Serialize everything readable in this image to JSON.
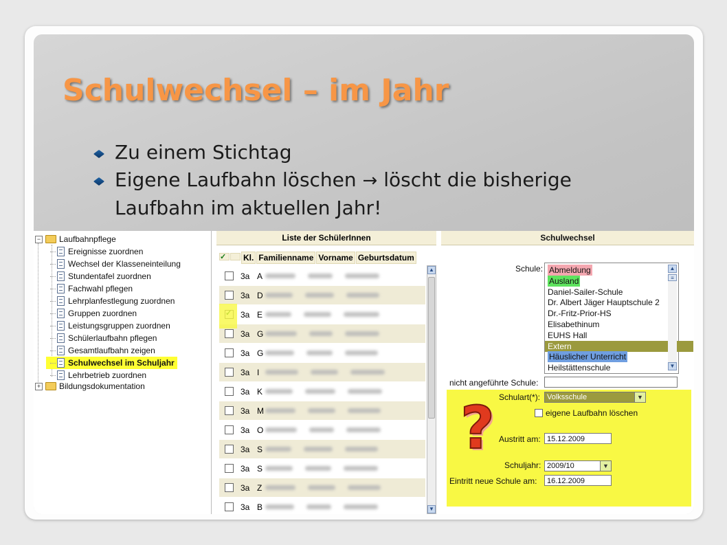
{
  "title": "Schulwechsel – im Jahr",
  "bullets": [
    {
      "text": "Zu einem Stichtag"
    },
    {
      "text_before": "Eigene Laufbahn löschen ",
      "arrow": "→",
      "text_after": " löscht die bisherige Laufbahn im aktuellen Jahr!"
    }
  ],
  "tree": {
    "root": "Laufbahnpflege",
    "items": [
      "Ereignisse zuordnen",
      "Wechsel der Klasseneinteilung",
      "Stundentafel zuordnen",
      "Fachwahl pflegen",
      "Lehrplanfestlegung zuordnen",
      "Gruppen zuordnen",
      "Leistungsgruppen zuordnen",
      "Schülerlaufbahn pflegen",
      "Gesamtlaufbahn zeigen",
      "Schulwechsel im Schuljahr",
      "Lehrbetrieb zuordnen"
    ],
    "second_root": "Bildungsdokumentation"
  },
  "student_list": {
    "title": "Liste der SchülerInnen",
    "columns": [
      "Kl.",
      "Familienname",
      "Vorname",
      "Geburtsdatum"
    ],
    "rows": [
      {
        "kl": "3a",
        "initial": "A",
        "checked": false
      },
      {
        "kl": "3a",
        "initial": "D",
        "checked": false
      },
      {
        "kl": "3a",
        "initial": "E",
        "checked": true
      },
      {
        "kl": "3a",
        "initial": "G",
        "checked": false
      },
      {
        "kl": "3a",
        "initial": "G",
        "checked": false
      },
      {
        "kl": "3a",
        "initial": "I",
        "checked": false
      },
      {
        "kl": "3a",
        "initial": "K",
        "checked": false
      },
      {
        "kl": "3a",
        "initial": "M",
        "checked": false
      },
      {
        "kl": "3a",
        "initial": "O",
        "checked": false
      },
      {
        "kl": "3a",
        "initial": "S",
        "checked": false
      },
      {
        "kl": "3a",
        "initial": "S",
        "checked": false
      },
      {
        "kl": "3a",
        "initial": "Z",
        "checked": false
      },
      {
        "kl": "3a",
        "initial": "B",
        "checked": false
      }
    ]
  },
  "schulwechsel": {
    "title": "Schulwechsel",
    "schule_label": "Schule:",
    "schools": [
      {
        "name": "Abmeldung",
        "highlight": "#f4a7b0"
      },
      {
        "name": "Ausland",
        "highlight": "#5ee35e"
      },
      {
        "name": "Daniel-Sailer-Schule",
        "highlight": ""
      },
      {
        "name": "Dr. Albert Jäger Hauptschule 2",
        "highlight": ""
      },
      {
        "name": "Dr.-Fritz-Prior-HS",
        "highlight": ""
      },
      {
        "name": "Elisabethinum",
        "highlight": ""
      },
      {
        "name": "EUHS Hall",
        "highlight": ""
      },
      {
        "name": "Extern",
        "highlight": "#9b9a3e"
      },
      {
        "name": "Häuslicher Unterricht",
        "highlight": "#6f9ee0"
      },
      {
        "name": "Heilstättenschule",
        "highlight": ""
      }
    ],
    "nicht_label": "nicht angeführte Schule:",
    "nicht_value": "",
    "schulart_label": "Schulart(*):",
    "schulart_value": "Volksschule",
    "laufbahn_label": "eigene Laufbahn löschen",
    "austritt_label": "Austritt am:",
    "austritt_value": "15.12.2009",
    "schuljahr_label": "Schuljahr:",
    "schuljahr_value": "2009/10",
    "eintritt_label": "Eintritt neue Schule am:",
    "eintritt_value": "16.12.2009",
    "question_mark": "?"
  },
  "colors": {
    "title": "#f79646",
    "highlight_yellow": "#ffff33",
    "section_yellow": "#f8f844",
    "panel_header": "#f4efd8"
  }
}
